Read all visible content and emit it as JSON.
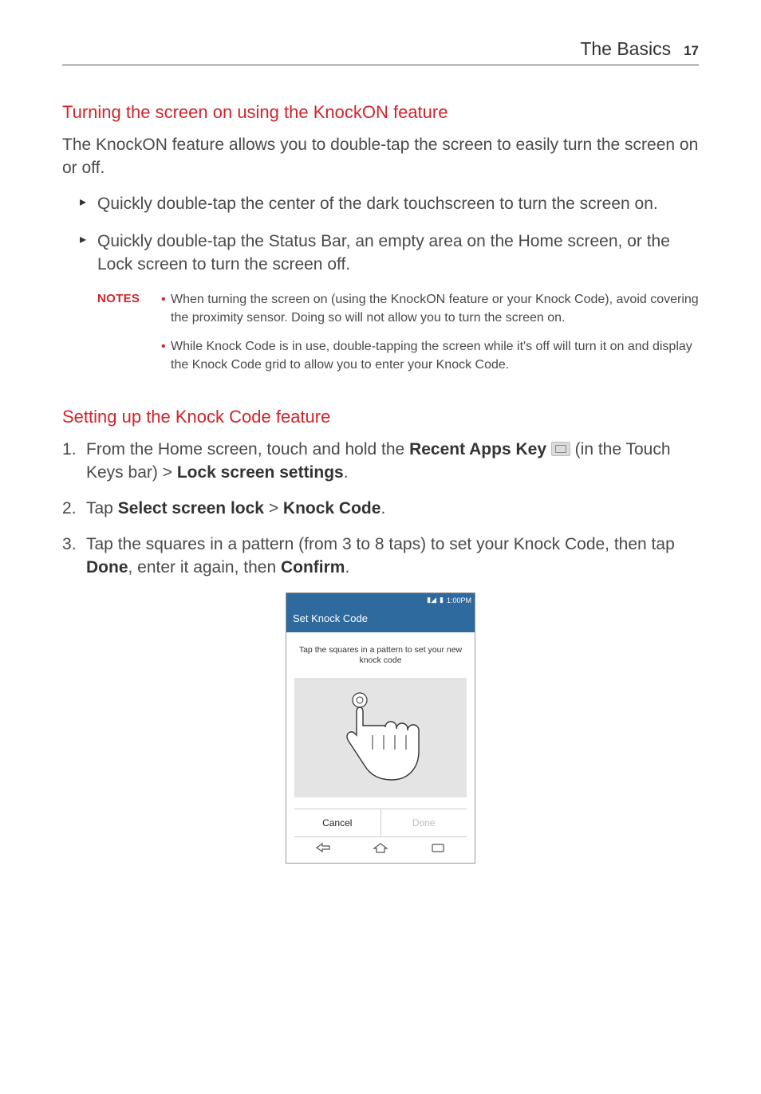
{
  "header": {
    "section": "The Basics",
    "page": "17"
  },
  "section1": {
    "heading": "Turning the screen on using the KnockON feature",
    "intro": "The KnockON feature allows you to double-tap the screen to easily turn the screen on or off.",
    "bullets": [
      "Quickly double-tap the center of the dark touchscreen to turn the screen on.",
      "Quickly double-tap the Status Bar, an empty area on the Home screen, or the Lock screen to turn the screen off."
    ],
    "notes_label": "NOTES",
    "notes": [
      "When turning the screen on (using the KnockON feature or your Knock Code), avoid covering the proximity sensor. Doing so will not allow you to turn the screen on.",
      "While Knock Code is in use, double-tapping the screen while it's off will turn it on and display the Knock Code grid to allow you to enter your Knock Code."
    ]
  },
  "section2": {
    "heading": "Setting up the Knock Code feature",
    "step1_a": "From the Home screen, touch and hold the ",
    "step1_b": "Recent Apps Key",
    "step1_c": " (in the Touch Keys bar) > ",
    "step1_d": "Lock screen settings",
    "step1_e": ".",
    "step2_a": "Tap ",
    "step2_b": "Select screen lock",
    "step2_c": " > ",
    "step2_d": "Knock Code",
    "step2_e": ".",
    "step3_a": "Tap the squares in a pattern (from 3 to 8 taps) to set your Knock Code, then tap ",
    "step3_b": "Done",
    "step3_c": ", enter it again, then ",
    "step3_d": "Confirm",
    "step3_e": "."
  },
  "phone": {
    "time": "1:00PM",
    "title": "Set Knock Code",
    "instruction": "Tap the squares in a pattern to set your new knock code",
    "cancel": "Cancel",
    "done": "Done"
  }
}
